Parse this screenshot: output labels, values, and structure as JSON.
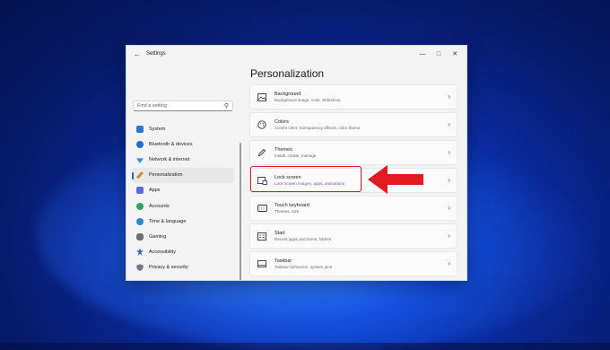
{
  "window": {
    "app_title": "Settings",
    "back_icon": "back-arrow-icon",
    "controls": [
      "minimize-icon",
      "maximize-icon",
      "close-icon"
    ]
  },
  "search": {
    "placeholder": "Find a setting"
  },
  "sidebar": {
    "items": [
      {
        "label": "System",
        "icon": "system-icon",
        "color": "#2b78d6"
      },
      {
        "label": "Bluetooth & devices",
        "icon": "bluetooth-icon",
        "color": "#1f6fd1"
      },
      {
        "label": "Network & internet",
        "icon": "wifi-icon",
        "color": "#2b8fe0"
      },
      {
        "label": "Personalization",
        "icon": "brush-icon",
        "color": "#c28a2b",
        "active": true
      },
      {
        "label": "Apps",
        "icon": "apps-icon",
        "color": "#5a6ad8"
      },
      {
        "label": "Accounts",
        "icon": "account-icon",
        "color": "#2ea06a"
      },
      {
        "label": "Time & language",
        "icon": "globe-clock-icon",
        "color": "#2f86d6"
      },
      {
        "label": "Gaming",
        "icon": "gamepad-icon",
        "color": "#6e6e6e"
      },
      {
        "label": "Accessibility",
        "icon": "accessibility-icon",
        "color": "#1f5fbf"
      },
      {
        "label": "Privacy & security",
        "icon": "shield-icon",
        "color": "#6f7a86"
      }
    ]
  },
  "main": {
    "title": "Personalization",
    "cards": [
      {
        "title": "Background",
        "subtitle": "Background image, color, slideshow",
        "icon": "picture-icon"
      },
      {
        "title": "Colors",
        "subtitle": "Accent color, transparency effects, color theme",
        "icon": "palette-icon"
      },
      {
        "title": "Themes",
        "subtitle": "Install, create, manage",
        "icon": "pen-icon"
      },
      {
        "title": "Lock screen",
        "subtitle": "Lock screen images, apps, animations",
        "icon": "lock-screen-icon"
      },
      {
        "title": "Touch keyboard",
        "subtitle": "Themes, size",
        "icon": "keyboard-icon"
      },
      {
        "title": "Start",
        "subtitle": "Recent apps and items, folders",
        "icon": "start-icon"
      },
      {
        "title": "Taskbar",
        "subtitle": "Taskbar behaviors, system pins",
        "icon": "taskbar-icon"
      }
    ]
  },
  "annotation": {
    "color": "#e11b22",
    "target": "Lock screen"
  }
}
